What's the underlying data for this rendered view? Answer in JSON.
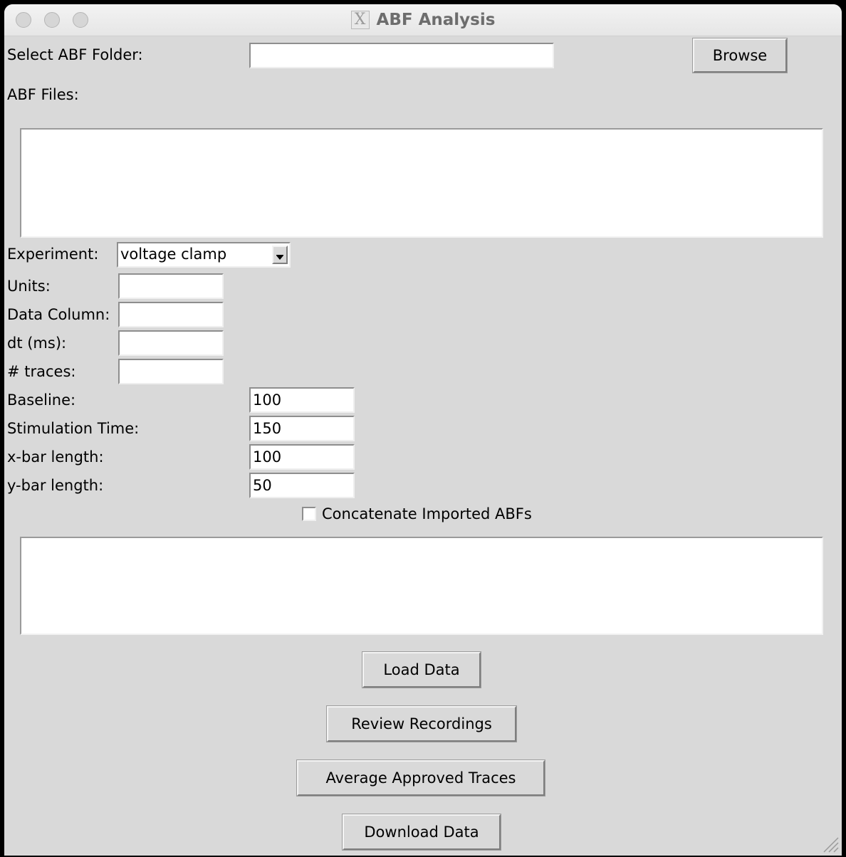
{
  "window": {
    "title": "ABF Analysis",
    "title_icon": "x11-icon"
  },
  "folder": {
    "label": "Select ABF Folder:",
    "value": "",
    "browse_label": "Browse"
  },
  "files": {
    "label": "ABF Files:"
  },
  "experiment": {
    "label": "Experiment:",
    "selected": "voltage clamp"
  },
  "units": {
    "label": "Units:",
    "value": ""
  },
  "data_column": {
    "label": "Data Column:",
    "value": ""
  },
  "dt": {
    "label": "dt (ms):",
    "value": ""
  },
  "traces": {
    "label": "# traces:",
    "value": ""
  },
  "baseline": {
    "label": "Baseline:",
    "value": "100"
  },
  "stim_time": {
    "label": "Stimulation Time:",
    "value": "150"
  },
  "xbar": {
    "label": "x-bar length:",
    "value": "100"
  },
  "ybar": {
    "label": "y-bar length:",
    "value": "50"
  },
  "concatenate": {
    "label": "Concatenate Imported ABFs",
    "checked": false
  },
  "buttons": {
    "load": "Load Data",
    "review": "Review Recordings",
    "average": "Average Approved Traces",
    "download": "Download Data"
  }
}
